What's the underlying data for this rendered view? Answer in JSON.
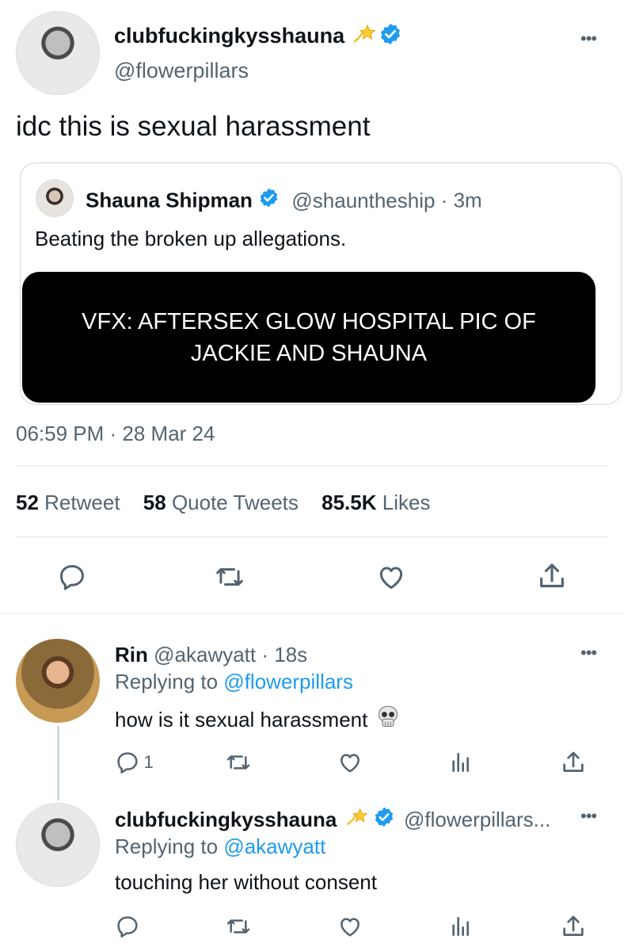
{
  "main_tweet": {
    "display_name": "clubfuckingkysshauna",
    "handle": "@flowerpillars",
    "text": "idc this is sexual harassment",
    "quoted": {
      "display_name": "Shauna Shipman",
      "handle": "@shauntheship",
      "time": "· 3m",
      "text": "Beating the broken up allegations.",
      "media_text": "VFX: AFTERSEX GLOW HOSPITAL PIC OF JACKIE AND SHAUNA"
    },
    "timestamp": "06:59 PM · 28 Mar 24",
    "stats": {
      "retweets_count": "52",
      "retweets_label": "Retweet",
      "quotes_count": "58",
      "quotes_label": "Quote Tweets",
      "likes_count": "85.5K",
      "likes_label": "Likes"
    }
  },
  "reply1": {
    "display_name": "Rin",
    "handle": "@akawyatt",
    "time": "· 18s",
    "replying_to_label": "Replying to",
    "replying_to_handle": "@flowerpillars",
    "text": "how is it sexual harassment",
    "reply_count": "1"
  },
  "reply2": {
    "display_name": "clubfuckingkysshauna",
    "handle": "@flowerpillars...",
    "replying_to_label": "Replying to",
    "replying_to_handle": "@akawyatt",
    "text": "touching her without consent"
  },
  "icons": {
    "more": "more-icon",
    "reply": "reply-icon",
    "retweet": "retweet-icon",
    "like": "heart-icon",
    "share": "share-icon",
    "analytics": "analytics-icon",
    "verified": "verified-badge-icon",
    "sparkle": "dizzy-star-emoji",
    "skull": "skull-emoji"
  },
  "colors": {
    "text": "#0f1419",
    "secondary": "#536471",
    "accent": "#1d9bf0",
    "border": "#e3e7ea",
    "media_bg": "#000000"
  }
}
